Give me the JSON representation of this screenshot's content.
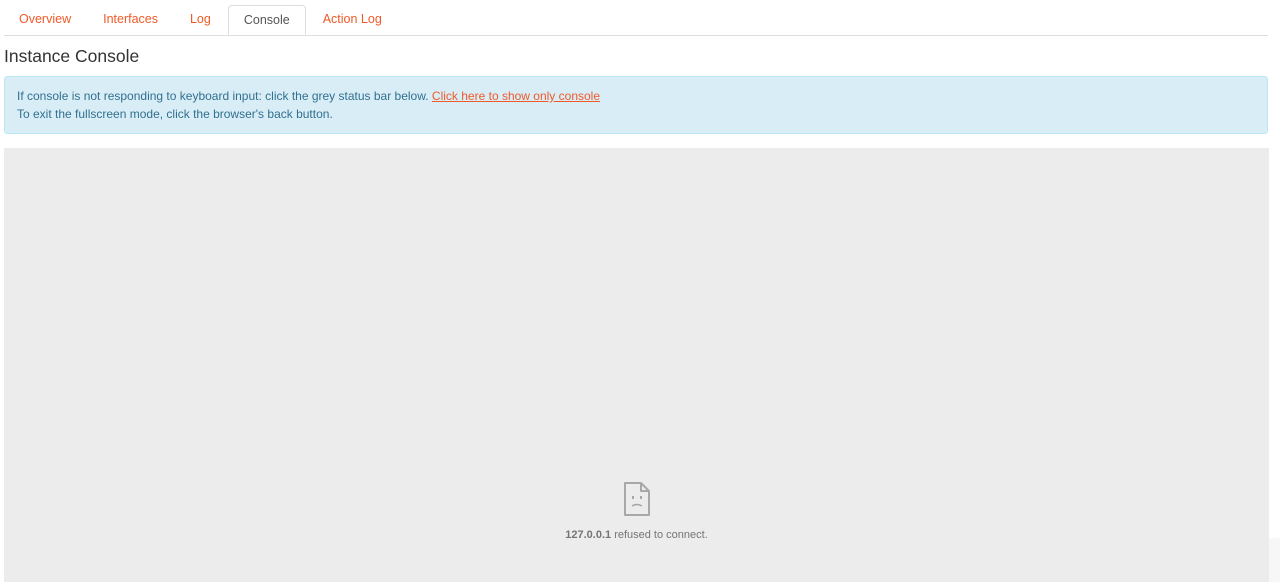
{
  "tabs": [
    {
      "label": "Overview",
      "active": false
    },
    {
      "label": "Interfaces",
      "active": false
    },
    {
      "label": "Log",
      "active": false
    },
    {
      "label": "Console",
      "active": true
    },
    {
      "label": "Action Log",
      "active": false
    }
  ],
  "page_title": "Instance Console",
  "alert": {
    "line1": "If console is not responding to keyboard input: click the grey status bar below.",
    "link": "Click here to show only console",
    "line2": "To exit the fullscreen mode, click the browser's back button."
  },
  "console": {
    "error_host": "127.0.0.1",
    "error_text": "refused to connect.",
    "error_icon": "sad-page-icon"
  },
  "colors": {
    "accent": "#f05a28",
    "alert_bg": "#d9edf7",
    "alert_text": "#31708f",
    "console_bg": "#ececec"
  }
}
